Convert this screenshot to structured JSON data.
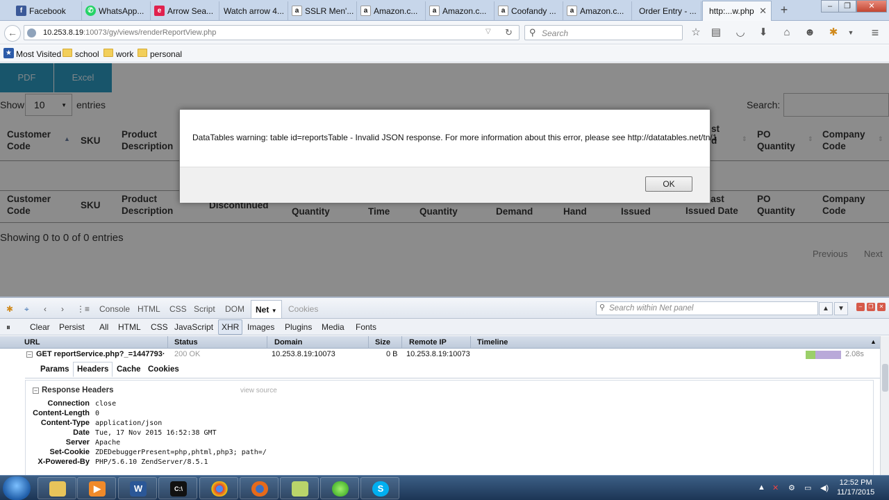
{
  "browser": {
    "tabs": [
      {
        "label": "Facebook",
        "icon": "facebook-icon",
        "color": "#3b5998",
        "glyph": "f"
      },
      {
        "label": "WhatsApp...",
        "icon": "whatsapp-icon",
        "color": "#25d366",
        "glyph": "✆"
      },
      {
        "label": "Arrow Sea...",
        "icon": "arrow-icon",
        "color": "#e0214d",
        "glyph": "e"
      },
      {
        "label": "Watch arrow 4...",
        "icon": "video-icon",
        "color": "#c7d6ea",
        "glyph": ""
      },
      {
        "label": "SSLR Men'...",
        "icon": "amazon-icon",
        "color": "#111111",
        "glyph": "a"
      },
      {
        "label": "Amazon.c...",
        "icon": "amazon-icon",
        "color": "#111111",
        "glyph": "a"
      },
      {
        "label": "Amazon.c...",
        "icon": "amazon-icon",
        "color": "#111111",
        "glyph": "a"
      },
      {
        "label": "Coofandy ...",
        "icon": "amazon-icon",
        "color": "#111111",
        "glyph": "a"
      },
      {
        "label": "Amazon.c...",
        "icon": "amazon-icon",
        "color": "#111111",
        "glyph": "a"
      },
      {
        "label": "Order Entry - ...",
        "icon": "page-icon",
        "color": "#c7d6ea",
        "glyph": ""
      },
      {
        "label": "http:...w.php",
        "icon": "page-icon",
        "color": "#f6f8fb",
        "glyph": "",
        "active": true
      }
    ],
    "url_host": "10.253.8.19",
    "url_rest": ":10073/gy/views/renderReportView.php",
    "search_placeholder": "Search",
    "bookmarks": [
      "Most Visited",
      "school",
      "work",
      "personal"
    ]
  },
  "report": {
    "export_buttons": [
      "PDF",
      "Excel"
    ],
    "show_label": "Show",
    "page_length": "10",
    "entries_label": "entries",
    "search_label": "Search:",
    "header_top": [
      "Customer Code",
      "SKU",
      "Product Description",
      "st d",
      "PO Quantity",
      "Company Code"
    ],
    "header_bottom": [
      "Customer Code",
      "SKU",
      "Product Description",
      "Discontinued",
      "Quantity",
      "Time",
      "Quantity",
      "Demand",
      "Hand",
      "Issued",
      "Last Issued Date",
      "PO Quantity",
      "Company Code"
    ],
    "info": "Showing 0 to 0 of 0 entries",
    "pager": [
      "Previous",
      "Next"
    ]
  },
  "dialog": {
    "message": "DataTables warning: table id=reportsTable - Invalid JSON response. For more information about this error, please see http://datatables.net/tn/1",
    "ok_label": "OK"
  },
  "firebug": {
    "panels": [
      "Console",
      "HTML",
      "CSS",
      "Script",
      "DOM",
      "Net",
      "Cookies"
    ],
    "active_panel": "Net",
    "search_placeholder": "Search within Net panel",
    "filters": [
      "Clear",
      "Persist",
      "All",
      "HTML",
      "CSS",
      "JavaScript",
      "XHR",
      "Images",
      "Plugins",
      "Media",
      "Fonts"
    ],
    "active_filter": "XHR",
    "columns": [
      "URL",
      "Status",
      "Domain",
      "Size",
      "Remote IP",
      "Timeline"
    ],
    "request": {
      "url": "GET reportService.php?_=1447793·",
      "status": "200 OK",
      "domain": "10.253.8.19:10073",
      "size": "0 B",
      "remote_ip": "10.253.8.19:10073",
      "time": "2.08s"
    },
    "subtabs": [
      "Params",
      "Headers",
      "Cache",
      "Cookies"
    ],
    "active_subtab": "Headers",
    "response_title": "Response Headers",
    "view_source": "view source",
    "headers": [
      {
        "name": "Connection",
        "value": "close"
      },
      {
        "name": "Content-Length",
        "value": "0"
      },
      {
        "name": "Content-Type",
        "value": "application/json"
      },
      {
        "name": "Date",
        "value": "Tue, 17 Nov 2015 16:52:38 GMT"
      },
      {
        "name": "Server",
        "value": "Apache"
      },
      {
        "name": "Set-Cookie",
        "value": "ZDEDebuggerPresent=php,phtml,php3; path=/"
      },
      {
        "name": "X-Powered-By",
        "value": "PHP/5.6.10 ZendServer/8.5.1"
      }
    ]
  },
  "taskbar": {
    "apps": [
      "explorer-icon",
      "media-player-icon",
      "word-icon",
      "cmd-icon",
      "chrome-icon",
      "firefox-icon",
      "notepad-icon",
      "green-app-icon",
      "skype-icon"
    ],
    "time": "12:52 PM",
    "date": "11/17/2015"
  }
}
